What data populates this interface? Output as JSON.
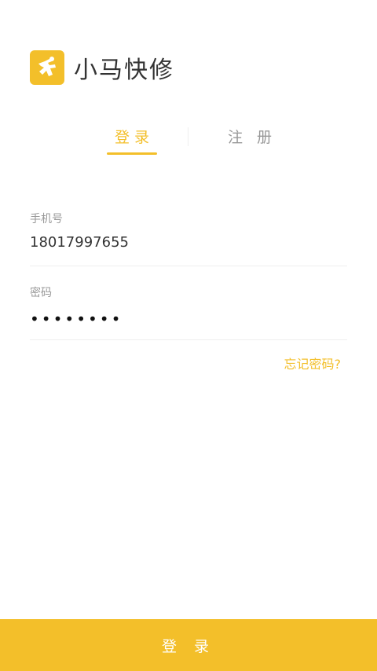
{
  "brand": {
    "name": "小马快修",
    "logo_icon": "running-horse-icon",
    "accent_color": "#f3bf2a"
  },
  "tabs": [
    {
      "label": "登录",
      "active": true
    },
    {
      "label": "注 册",
      "active": false
    }
  ],
  "form": {
    "phone": {
      "label": "手机号",
      "value": "18017997655"
    },
    "password": {
      "label": "密码",
      "masked_value": "••••••••"
    },
    "forgot_label": "忘记密码?"
  },
  "submit_label": "登 录"
}
